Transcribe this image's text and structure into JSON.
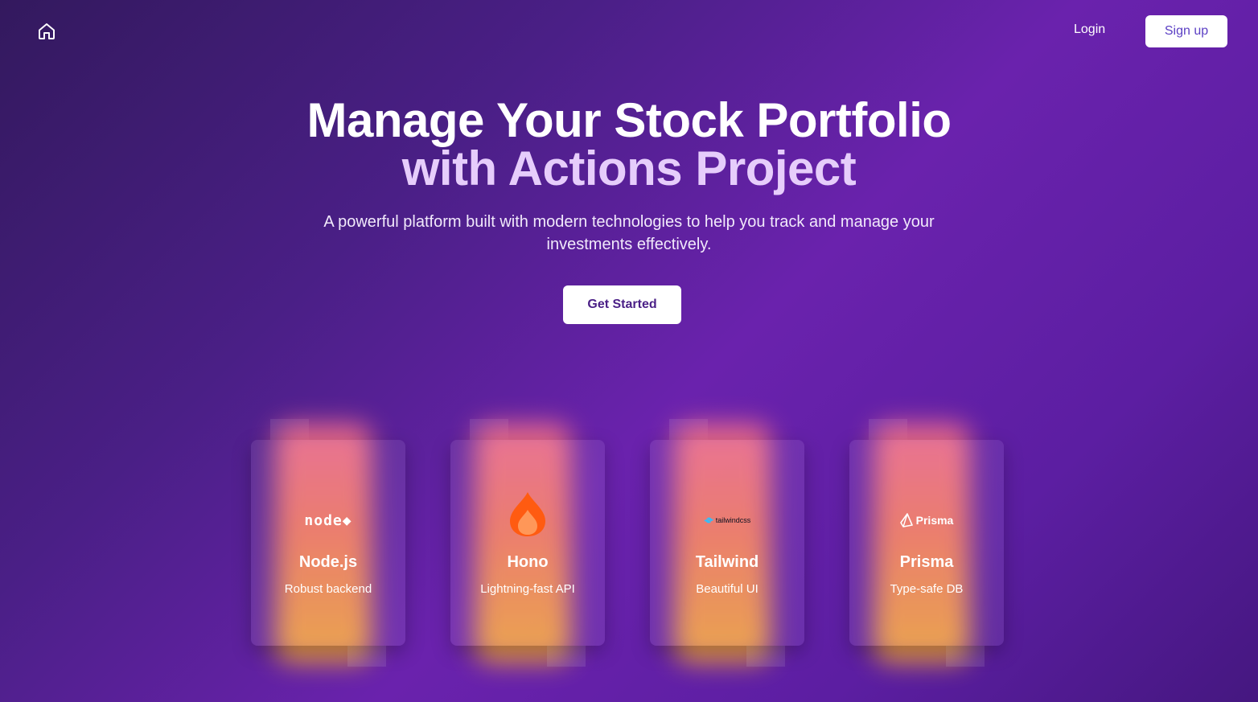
{
  "nav": {
    "home_icon": "home-icon",
    "login": "Login",
    "signup": "Sign up"
  },
  "hero": {
    "title_line1": "Manage Your Stock Portfolio",
    "title_line2": "with Actions Project",
    "subtitle": "A powerful platform built with modern technologies to help you track and manage your investments effectively.",
    "cta": "Get Started"
  },
  "cards": [
    {
      "title": "Node.js",
      "subtitle": "Robust backend",
      "logo": "nodejs-logo",
      "logo_text": "node"
    },
    {
      "title": "Hono",
      "subtitle": "Lightning-fast API",
      "logo": "hono-flame-logo"
    },
    {
      "title": "Tailwind",
      "subtitle": "Beautiful UI",
      "logo": "tailwind-logo",
      "logo_text": "tailwindcss"
    },
    {
      "title": "Prisma",
      "subtitle": "Type-safe DB",
      "logo": "prisma-logo",
      "logo_text": "Prisma"
    }
  ],
  "colors": {
    "accent": "#5b3fc4",
    "background_dark": "#33195e",
    "background_mid": "#6a22ad",
    "glow_top": "#ef6b8f",
    "glow_bottom": "#f1a63a"
  }
}
